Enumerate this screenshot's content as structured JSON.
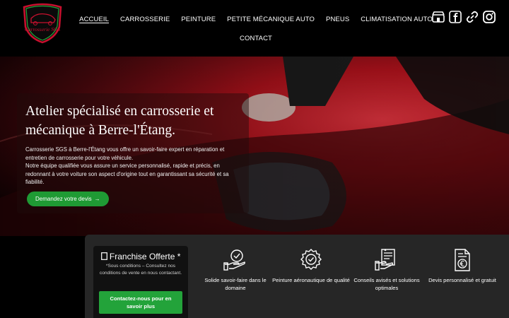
{
  "brand": {
    "logo_text": "Carrosserie SGS"
  },
  "nav": {
    "items": [
      {
        "label": "ACCUEIL",
        "active": true
      },
      {
        "label": "CARROSSERIE"
      },
      {
        "label": "PEINTURE"
      },
      {
        "label": "PETITE MÉCANIQUE AUTO"
      },
      {
        "label": "PNEUS"
      },
      {
        "label": "CLIMATISATION AUTO"
      },
      {
        "label": "CONTACT"
      }
    ]
  },
  "social": [
    "shop-icon",
    "facebook-icon",
    "link-icon",
    "instagram-icon"
  ],
  "hero": {
    "title": "Atelier spécialisé en carrosserie et mécanique à Berre-l'Étang.",
    "paragraph1": "Carrosserie SGS à Berre-l'Étang vous offre un savoir-faire expert en réparation et entretien de carrosserie pour votre véhicule.",
    "paragraph2": "Notre équipe qualifiée vous assure un service personnalisé, rapide et précis, en redonnant à votre voiture son aspect d'origine tout en garantissant sa sécurité et sa fiabilité.",
    "cta_label": "Demandez votre devis",
    "cta_arrow": "→"
  },
  "offer": {
    "title": "Franchise Offerte *",
    "icon": "document-icon",
    "note": "*Sous conditions – Consultez nos conditions de vente en nous contactant.",
    "cta_label": "Contactez-nous pour en savoir plus"
  },
  "features": [
    {
      "icon": "hand-check-icon",
      "label": "Solide savoir-faire dans le domaine"
    },
    {
      "icon": "gear-badge-icon",
      "label": "Peinture aéronautique de qualité"
    },
    {
      "icon": "advice-icon",
      "label": "Conseils avisés et solutions optimales"
    },
    {
      "icon": "euro-document-icon",
      "label": "Devis personnalisé et gratuit"
    }
  ],
  "colors": {
    "accent_green": "#23a33a",
    "background": "#000000",
    "panel": "#262626",
    "brand_red": "#c8102e"
  }
}
